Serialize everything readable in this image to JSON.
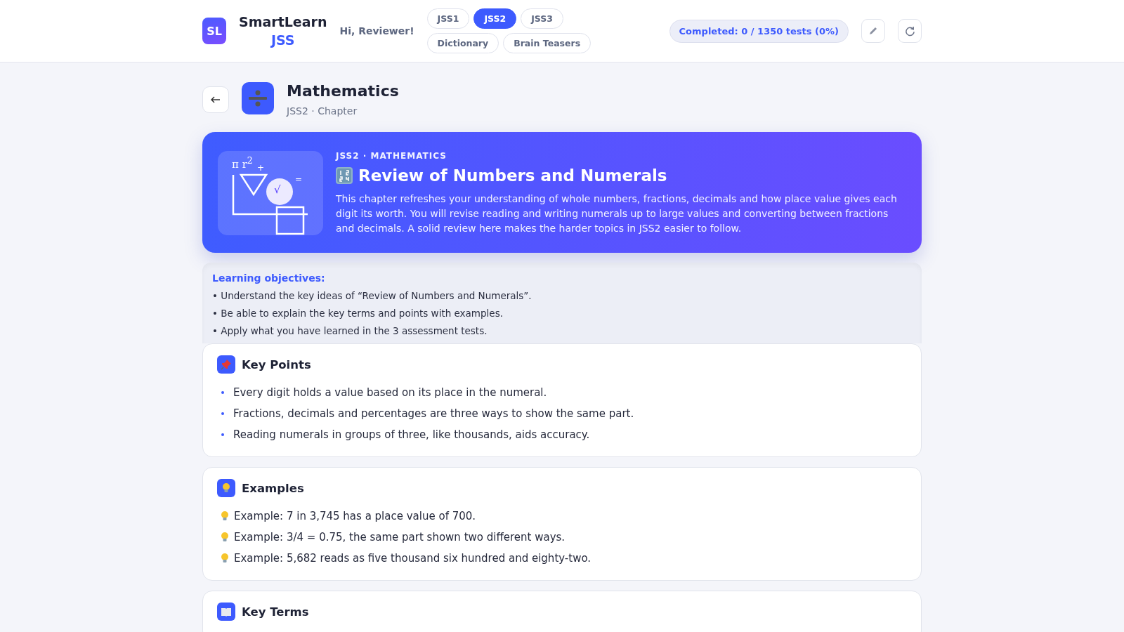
{
  "brand": {
    "logo": "SL",
    "name": "SmartLearn",
    "sub": "JSS"
  },
  "greeting": "Hi, Reviewer!",
  "tabs": [
    {
      "label": "JSS1",
      "selected": false
    },
    {
      "label": "JSS2",
      "selected": true
    },
    {
      "label": "JSS3",
      "selected": false
    },
    {
      "label": "Dictionary",
      "selected": false
    },
    {
      "label": "Brain Teasers",
      "selected": false
    }
  ],
  "progress": "Completed: 0 / 1350 tests (0%)",
  "subject": {
    "title": "Mathematics",
    "subtitle": "JSS2 · Chapter"
  },
  "hero": {
    "eyebrow": "JSS2 · MATHEMATICS",
    "title": "Review of Numbers and Numerals",
    "description": "This chapter refreshes your understanding of whole numbers, fractions, decimals and how place value gives each digit its worth. You will revise reading and writing numerals up to large values and converting between fractions and decimals. A solid review here makes the harder topics in JSS2 easier to follow.",
    "symbols": [
      "π r$^{2}$",
      "+",
      "=",
      "√"
    ]
  },
  "objectives": {
    "title": "Learning objectives:",
    "items": [
      "• Understand the key ideas of “Review of Numbers and Numerals”.",
      "• Be able to explain the key terms and points with examples.",
      "• Apply what you have learned in the 3 assessment tests."
    ]
  },
  "sections": [
    {
      "kind": "points",
      "title": "Key Points",
      "items": [
        "Every digit holds a value based on its place in the numeral.",
        "Fractions, decimals and percentages are three ways to show the same part.",
        "Reading numerals in groups of three, like thousands, aids accuracy."
      ]
    },
    {
      "kind": "examples",
      "title": "Examples",
      "items": [
        "Example: 7 in 3,745 has a place value of 700.",
        "Example: 3/4 = 0.75, the same part shown two different ways.",
        "Example: 5,682 reads as five thousand six hundred and eighty-two."
      ]
    },
    {
      "kind": "terms",
      "title": "Key Terms"
    }
  ]
}
